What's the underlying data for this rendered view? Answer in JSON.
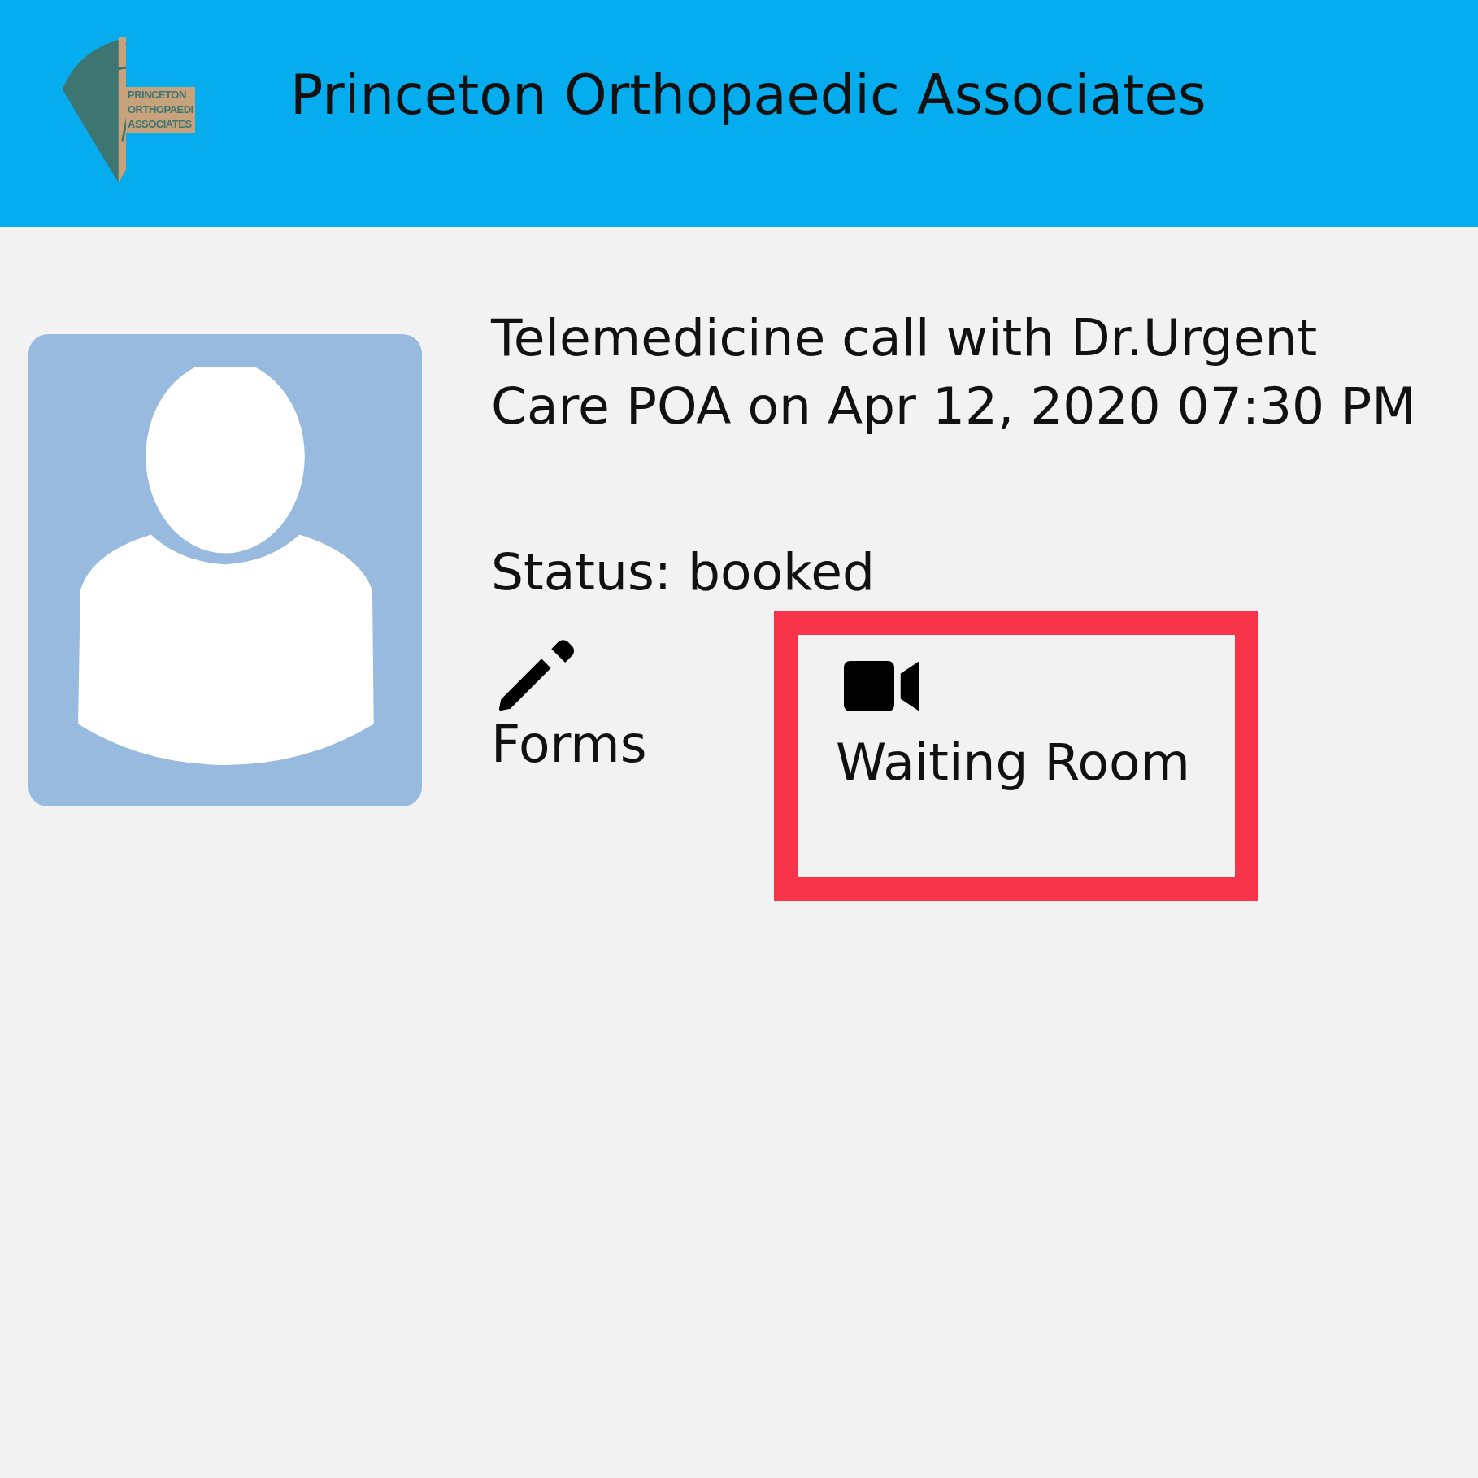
{
  "header": {
    "title": "Princeton Orthopaedic Associates",
    "logo_lines": [
      "PRINCETON",
      "ORTHOPAEDI",
      "ASSOCIATES"
    ]
  },
  "appointment": {
    "description": "Telemedicine call with Dr.Urgent Care POA on Apr 12, 2020 07:30 PM",
    "status": "Status: booked"
  },
  "actions": [
    {
      "kind": "forms",
      "label": "Forms",
      "highlighted": false
    },
    {
      "kind": "video",
      "label": "Waiting Room",
      "highlighted": true
    }
  ]
}
